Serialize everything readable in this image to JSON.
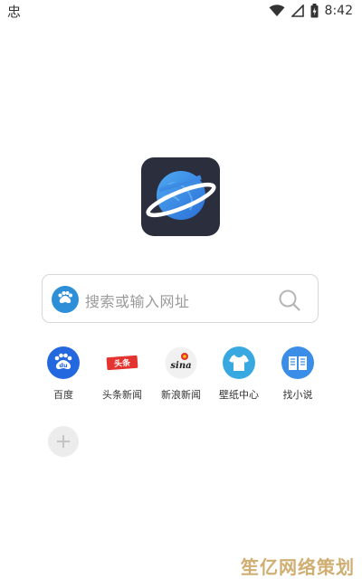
{
  "status_bar": {
    "left_glyph": "忠",
    "time": "8:42",
    "icons": [
      "wifi-icon",
      "signal-icon",
      "battery-icon"
    ]
  },
  "logo": {
    "icon": "planet-icon",
    "background_color": "#2b2f3d",
    "planet_color": "#3a8ee8"
  },
  "search": {
    "placeholder": "搜索或输入网址",
    "engine_icon": "baidu-icon",
    "search_icon": "search-icon"
  },
  "shortcuts": [
    {
      "label": "百度",
      "icon": "baidu-icon",
      "color": "#2468e0"
    },
    {
      "label": "头条新闻",
      "icon": "toutiao-icon",
      "badge_text": "头条",
      "color": "#e3342f"
    },
    {
      "label": "新浪新闻",
      "icon": "sina-icon",
      "badge_text": "sina",
      "color": "#e3342f"
    },
    {
      "label": "壁纸中心",
      "icon": "tshirt-icon",
      "color": "#38a9e0"
    },
    {
      "label": "找小说",
      "icon": "book-icon",
      "color": "#3a8ee8"
    }
  ],
  "add_shortcut": {
    "icon": "plus-icon"
  },
  "watermark": "笙亿网络策划"
}
